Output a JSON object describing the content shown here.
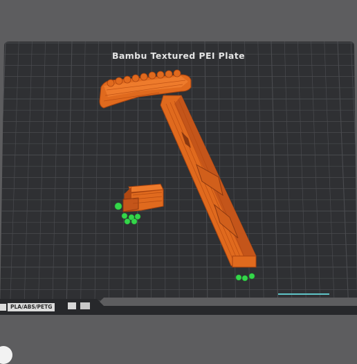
{
  "plate": {
    "label": "Bambu Textured PEI Plate",
    "filament_badge": "PLA/ABS/PETG"
  },
  "colors": {
    "background": "#5d5d5f",
    "bed": "#2f3033",
    "grid": "#4a4b4f",
    "part": "#e06a1e",
    "part_dark": "#b04812",
    "support_contact": "#35d64a"
  },
  "icons": [
    "filament-icon",
    "plate-shape-icon"
  ]
}
